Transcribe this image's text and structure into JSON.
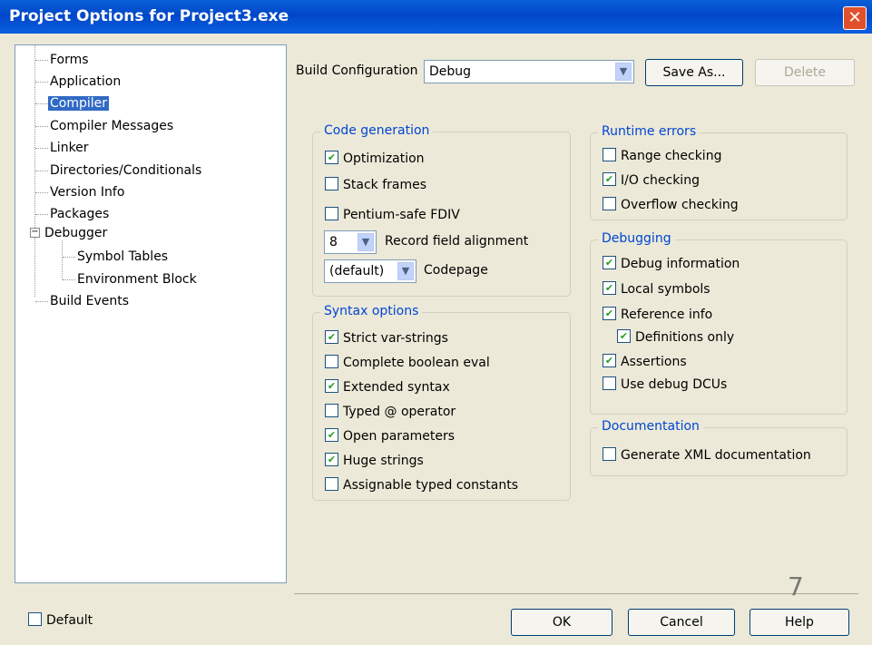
{
  "window": {
    "title": "Project Options for Project3.exe"
  },
  "tree": {
    "items": [
      {
        "label": "Forms"
      },
      {
        "label": "Application"
      },
      {
        "label": "Compiler"
      },
      {
        "label": "Compiler Messages"
      },
      {
        "label": "Linker"
      },
      {
        "label": "Directories/Conditionals"
      },
      {
        "label": "Version Info"
      },
      {
        "label": "Packages"
      },
      {
        "label": "Debugger"
      },
      {
        "label": "Symbol Tables"
      },
      {
        "label": "Environment Block"
      },
      {
        "label": "Build Events"
      }
    ],
    "selected": "Compiler"
  },
  "build_config": {
    "label": "Build Configuration",
    "value": "Debug",
    "save_as": "Save As...",
    "delete": "Delete"
  },
  "code_generation": {
    "title": "Code generation",
    "optimization": {
      "label": "Optimization",
      "checked": true
    },
    "stack_frames": {
      "label": "Stack frames",
      "checked": false
    },
    "pentium_fdiv": {
      "label": "Pentium-safe FDIV",
      "checked": false
    },
    "record_alignment": {
      "value": "8",
      "label": "Record field alignment"
    },
    "codepage": {
      "value": "(default)",
      "label": "Codepage"
    }
  },
  "syntax_options": {
    "title": "Syntax options",
    "items": [
      {
        "label": "Strict var-strings",
        "checked": true
      },
      {
        "label": "Complete boolean eval",
        "checked": false
      },
      {
        "label": "Extended syntax",
        "checked": true
      },
      {
        "label": "Typed @ operator",
        "checked": false
      },
      {
        "label": "Open parameters",
        "checked": true
      },
      {
        "label": "Huge strings",
        "checked": true
      },
      {
        "label": "Assignable typed constants",
        "checked": false
      }
    ]
  },
  "runtime_errors": {
    "title": "Runtime errors",
    "items": [
      {
        "label": "Range checking",
        "checked": false
      },
      {
        "label": "I/O checking",
        "checked": true
      },
      {
        "label": "Overflow checking",
        "checked": false
      }
    ]
  },
  "debugging": {
    "title": "Debugging",
    "items": [
      {
        "label": "Debug information",
        "checked": true
      },
      {
        "label": "Local symbols",
        "checked": true
      },
      {
        "label": "Reference info",
        "checked": true
      },
      {
        "label": "Definitions only",
        "checked": true
      },
      {
        "label": "Assertions",
        "checked": true
      },
      {
        "label": "Use debug DCUs",
        "checked": false
      }
    ]
  },
  "documentation": {
    "title": "Documentation",
    "generate_xml": {
      "label": "Generate XML documentation",
      "checked": false
    }
  },
  "footer": {
    "default_label": "Default",
    "default_checked": false,
    "ok": "OK",
    "cancel": "Cancel",
    "help": "Help",
    "page_number": "7"
  }
}
